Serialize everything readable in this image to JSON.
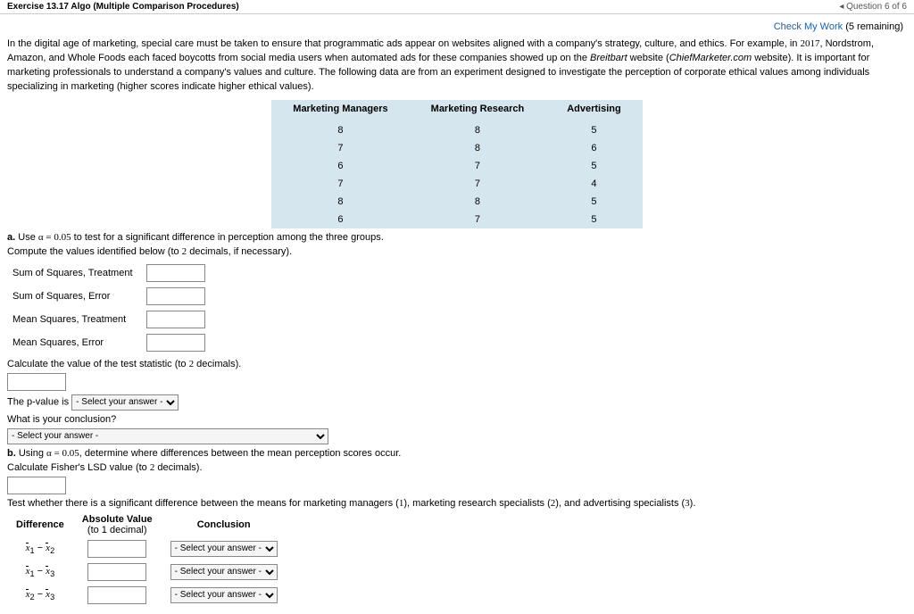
{
  "topbar": {
    "left": "Exercise 13.17 Algo (Multiple Comparison Procedures)",
    "right_prefix": "◂ Question ",
    "right_q": "6 of 6"
  },
  "check": {
    "link": "Check My Work",
    "remaining": "(5 remaining)"
  },
  "intro": {
    "p1a": "In the digital age of marketing, special care must be taken to ensure that programmatic ads appear on websites aligned with a company's strategy, culture, and ethics. For example, in ",
    "year": "2017",
    "p1b": ", Nordstrom, Amazon, and Whole Foods each faced boycotts from social media users when automated ads for these companies showed up on the ",
    "site1": "Breitbart",
    "p1c": " website (",
    "site2": "ChiefMarketer.com",
    "p1d": " website). It is important for marketing professionals to understand a company's values and culture. The following data are from an experiment designed to investigate the perception of corporate ethical values among individuals specializing in marketing (higher scores indicate higher ethical values)."
  },
  "table": {
    "headers": [
      "Marketing Managers",
      "Marketing Research",
      "Advertising"
    ],
    "rows": [
      [
        "8",
        "8",
        "5"
      ],
      [
        "7",
        "8",
        "6"
      ],
      [
        "6",
        "7",
        "5"
      ],
      [
        "7",
        "7",
        "4"
      ],
      [
        "8",
        "8",
        "5"
      ],
      [
        "6",
        "7",
        "5"
      ]
    ]
  },
  "partA": {
    "label_a": "a.",
    "text_a1": "Use ",
    "alpha": "α = 0.05",
    "text_a2": " to test for a significant difference in perception among the three groups.",
    "compute": "Compute the values identified below (to ",
    "two": "2",
    "compute2": " decimals, if necessary).",
    "rows": [
      "Sum of Squares, Treatment",
      "Sum of Squares, Error",
      "Mean Squares, Treatment",
      "Mean Squares, Error"
    ],
    "calcstat1": "Calculate the value of the test statistic (to ",
    "calcstat2": " decimals).",
    "pval_label": "The ",
    "pval_p": "p",
    "pval_label2": "-value is",
    "select_placeholder": "- Select your answer -",
    "conclusion_q": "What is your conclusion?"
  },
  "partB": {
    "label_b": "b.",
    "text_b1": "Using ",
    "alpha": "α = 0.05",
    "text_b2": ", determine where differences between the mean perception scores occur.",
    "lsd1": "Calculate Fisher's LSD value (to ",
    "two": "2",
    "lsd2": " decimals).",
    "testline1": "Test whether there is a significant difference between the means for marketing managers (",
    "g1": "1",
    "testline2": "), marketing research specialists (",
    "g2": "2",
    "testline3": "), and advertising specialists (",
    "g3": "3",
    "testline4": ")."
  },
  "diff": {
    "h1": "Difference",
    "h2a": "Absolute Value",
    "h2b": "(to 1 decimal)",
    "h3": "Conclusion",
    "select": "- Select your answer -",
    "pairs": [
      "12",
      "13",
      "23"
    ]
  }
}
